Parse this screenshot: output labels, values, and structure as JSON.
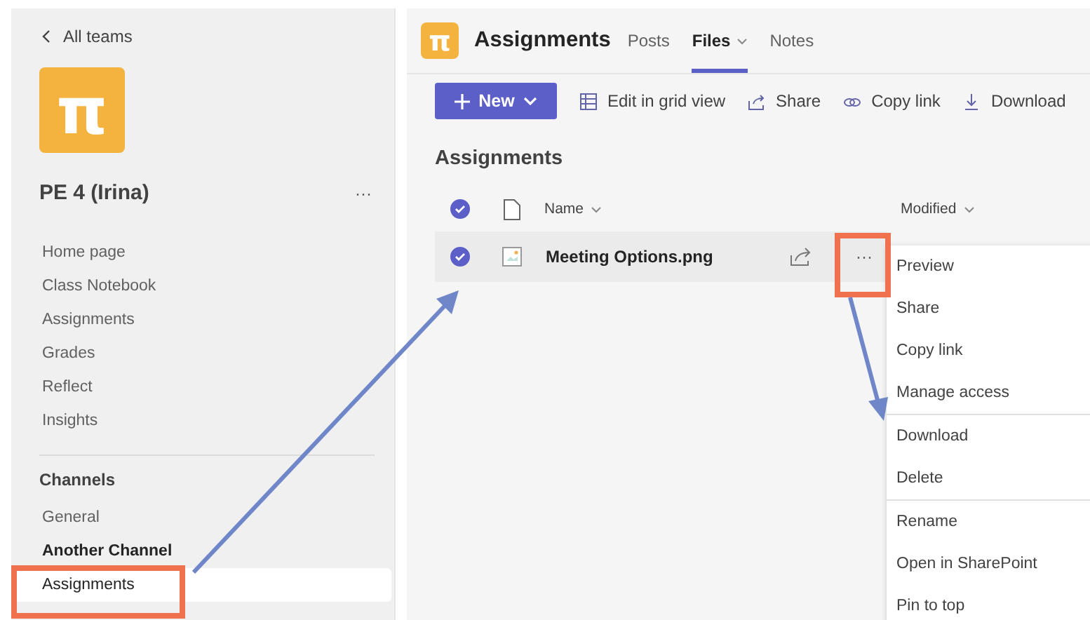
{
  "sidebar": {
    "back": "All teams",
    "logo_glyph": "π",
    "team_name": "PE 4 (Irina)",
    "more": "···",
    "items": [
      {
        "label": "Home page",
        "selected": false
      },
      {
        "label": "Class Notebook",
        "selected": false
      },
      {
        "label": "Assignments",
        "selected": false
      },
      {
        "label": "Grades",
        "selected": false
      },
      {
        "label": "Reflect",
        "selected": false
      },
      {
        "label": "Insights",
        "selected": false
      }
    ],
    "channels_heading": "Channels",
    "channels": [
      {
        "label": "General",
        "selected": false,
        "bold": false
      },
      {
        "label": "Another Channel",
        "selected": false,
        "bold": true
      },
      {
        "label": "Assignments",
        "selected": true,
        "bold": false
      }
    ]
  },
  "header": {
    "logo_glyph": "π",
    "title": "Assignments",
    "tabs": [
      {
        "label": "Posts",
        "selected": false,
        "dropdown": false
      },
      {
        "label": "Files",
        "selected": true,
        "dropdown": true
      },
      {
        "label": "Notes",
        "selected": false,
        "dropdown": false
      }
    ]
  },
  "toolbar": {
    "new_button": "New",
    "actions": [
      {
        "kind": "grid",
        "label": "Edit in grid view"
      },
      {
        "kind": "share",
        "label": "Share"
      },
      {
        "kind": "link",
        "label": "Copy link"
      },
      {
        "kind": "download",
        "label": "Download"
      }
    ]
  },
  "heading": "Assignments",
  "table": {
    "select_all": true,
    "columns": [
      "Name",
      "Modified"
    ],
    "rows": [
      {
        "name": "Meeting Options.png",
        "selected": true,
        "more": "···"
      }
    ]
  },
  "context_menu": {
    "groups": [
      [
        "Preview",
        "Share",
        "Copy link",
        "Manage access"
      ],
      [
        "Download",
        "Delete"
      ],
      [
        "Rename",
        "Open in SharePoint",
        "Pin to top"
      ]
    ]
  }
}
